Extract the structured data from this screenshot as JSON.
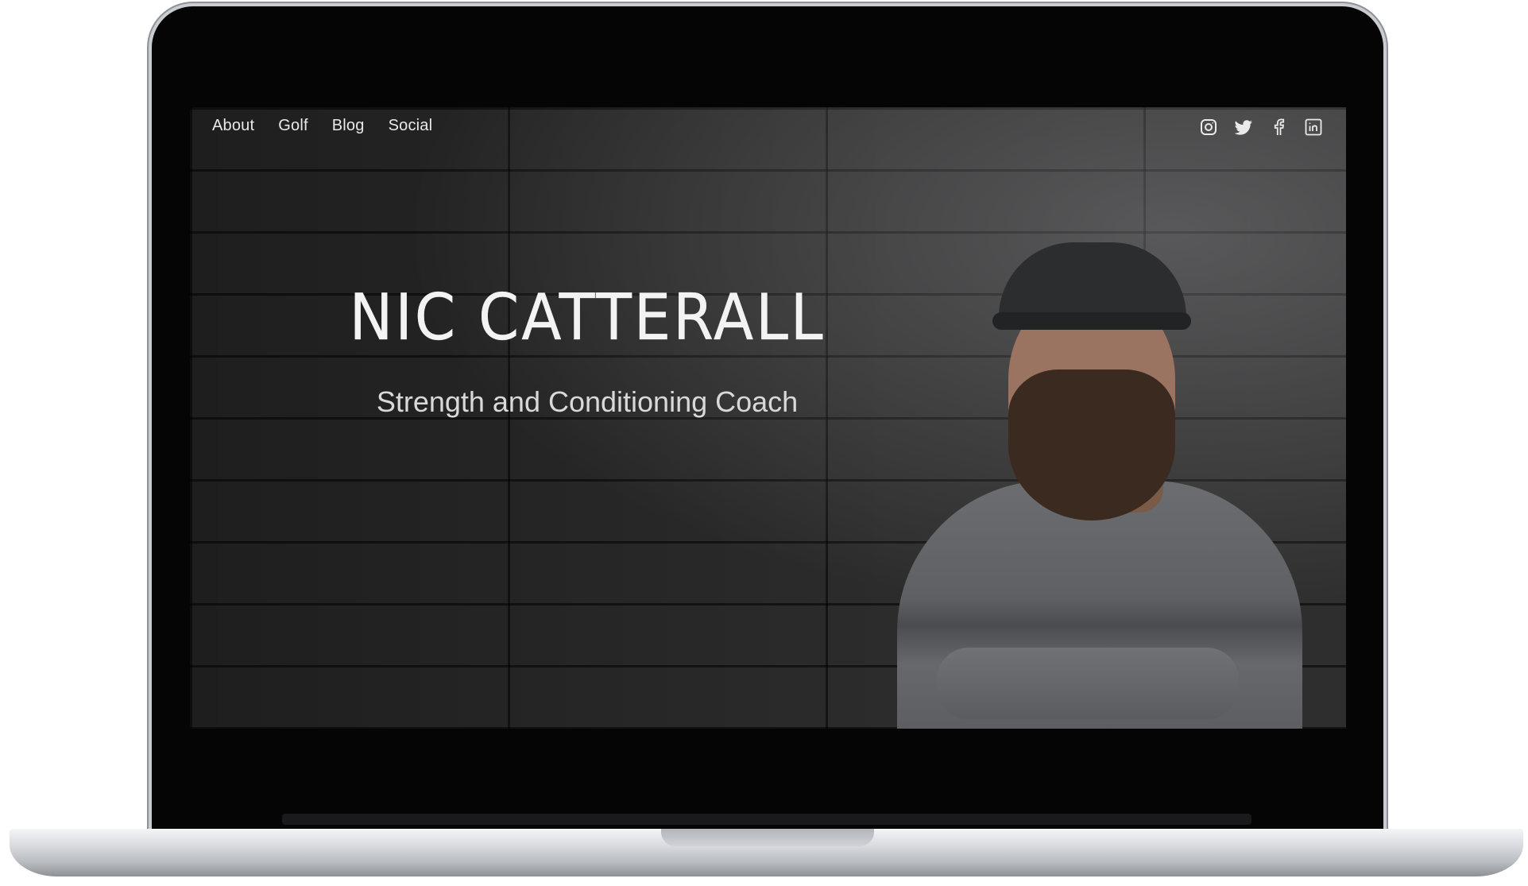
{
  "nav": {
    "items": [
      {
        "label": "About"
      },
      {
        "label": "Golf"
      },
      {
        "label": "Blog"
      },
      {
        "label": "Social"
      }
    ]
  },
  "social": {
    "icons": [
      "instagram-icon",
      "twitter-icon",
      "facebook-icon",
      "linkedin-icon"
    ]
  },
  "hero": {
    "title": "NIC CATTERALL",
    "subtitle": "Strength and Conditioning Coach"
  },
  "colors": {
    "nav_text": "#e9e9e9",
    "title_text": "#f3f3f3",
    "screen_bezel": "#050505"
  }
}
